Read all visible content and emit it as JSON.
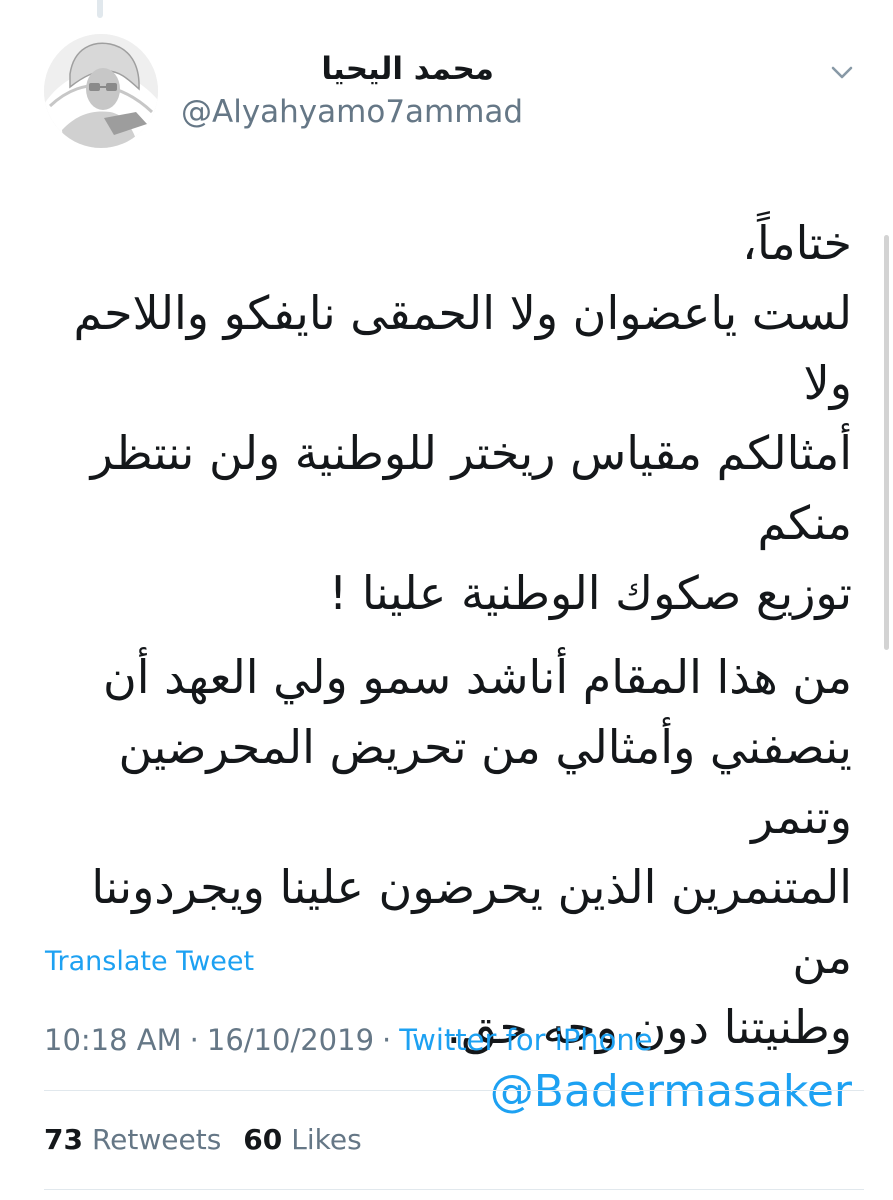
{
  "author": {
    "display_name": "محمد اليحيا",
    "username": "@Alyahyamo7ammad",
    "avatar": "avatar-photo-portrait"
  },
  "tweet": {
    "paragraphs": [
      [
        "ختاماً،",
        "لست ياعضوان ولا الحمقى نايفكو واللاحم ولا",
        "أمثالكم مقياس ريختر للوطنية ولن ننتظر منكم",
        "توزيع صكوك الوطنية علينا !"
      ],
      [
        "من هذا المقام أناشد سمو ولي العهد أن",
        "ينصفني وأمثالي من تحريض المحرضين وتنمر",
        "المتنمرين الذين يحرضون علينا ويجردوننا من",
        "وطنيتنا دون وجه حق."
      ]
    ],
    "mention": "@Badermasaker"
  },
  "actions": {
    "translate_label": "Translate Tweet",
    "chevron_icon": "chevron-down-icon"
  },
  "meta": {
    "time": "10:18 AM",
    "separator": "·",
    "date": "16/10/2019",
    "source": "Twitter for iPhone"
  },
  "stats": {
    "retweets_count": "73",
    "retweets_label": "Retweets",
    "likes_count": "60",
    "likes_label": "Likes"
  },
  "colors": {
    "link": "#1da1f2",
    "text_primary": "#14171a",
    "text_secondary": "#657786",
    "divider": "#e1e8ed"
  }
}
